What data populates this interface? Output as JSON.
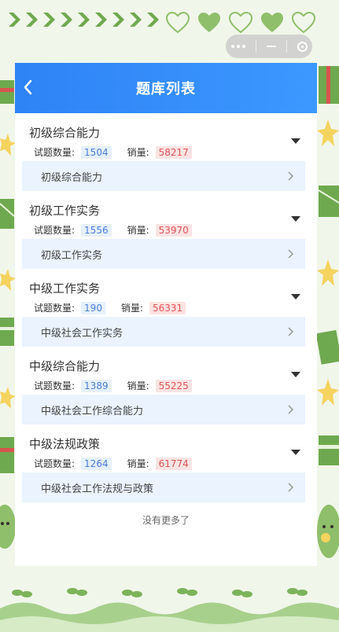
{
  "navbar": {
    "title": "题库列表"
  },
  "labels": {
    "count_label": "试题数量:",
    "sales_label": "销量:"
  },
  "groups": [
    {
      "title": "初级综合能力",
      "count": "1504",
      "sales": "58217",
      "sub": "初级综合能力"
    },
    {
      "title": "初级工作实务",
      "count": "1556",
      "sales": "53970",
      "sub": "初级工作实务"
    },
    {
      "title": "中级工作实务",
      "count": "190",
      "sales": "56331",
      "sub": "中级社会工作实务"
    },
    {
      "title": "中级综合能力",
      "count": "1389",
      "sales": "55225",
      "sub": "中级社会工作综合能力"
    },
    {
      "title": "中级法规政策",
      "count": "1264",
      "sales": "61774",
      "sub": "中级社会工作法规与政策"
    }
  ],
  "footer": {
    "no_more": "没有更多了"
  },
  "colors": {
    "navbar": "#2e83f5",
    "sub_row_bg": "#eaf3ff",
    "count_badge": "#e6f0fc",
    "sales_badge": "#fde3e3",
    "frame_green": "#6fa94f"
  }
}
